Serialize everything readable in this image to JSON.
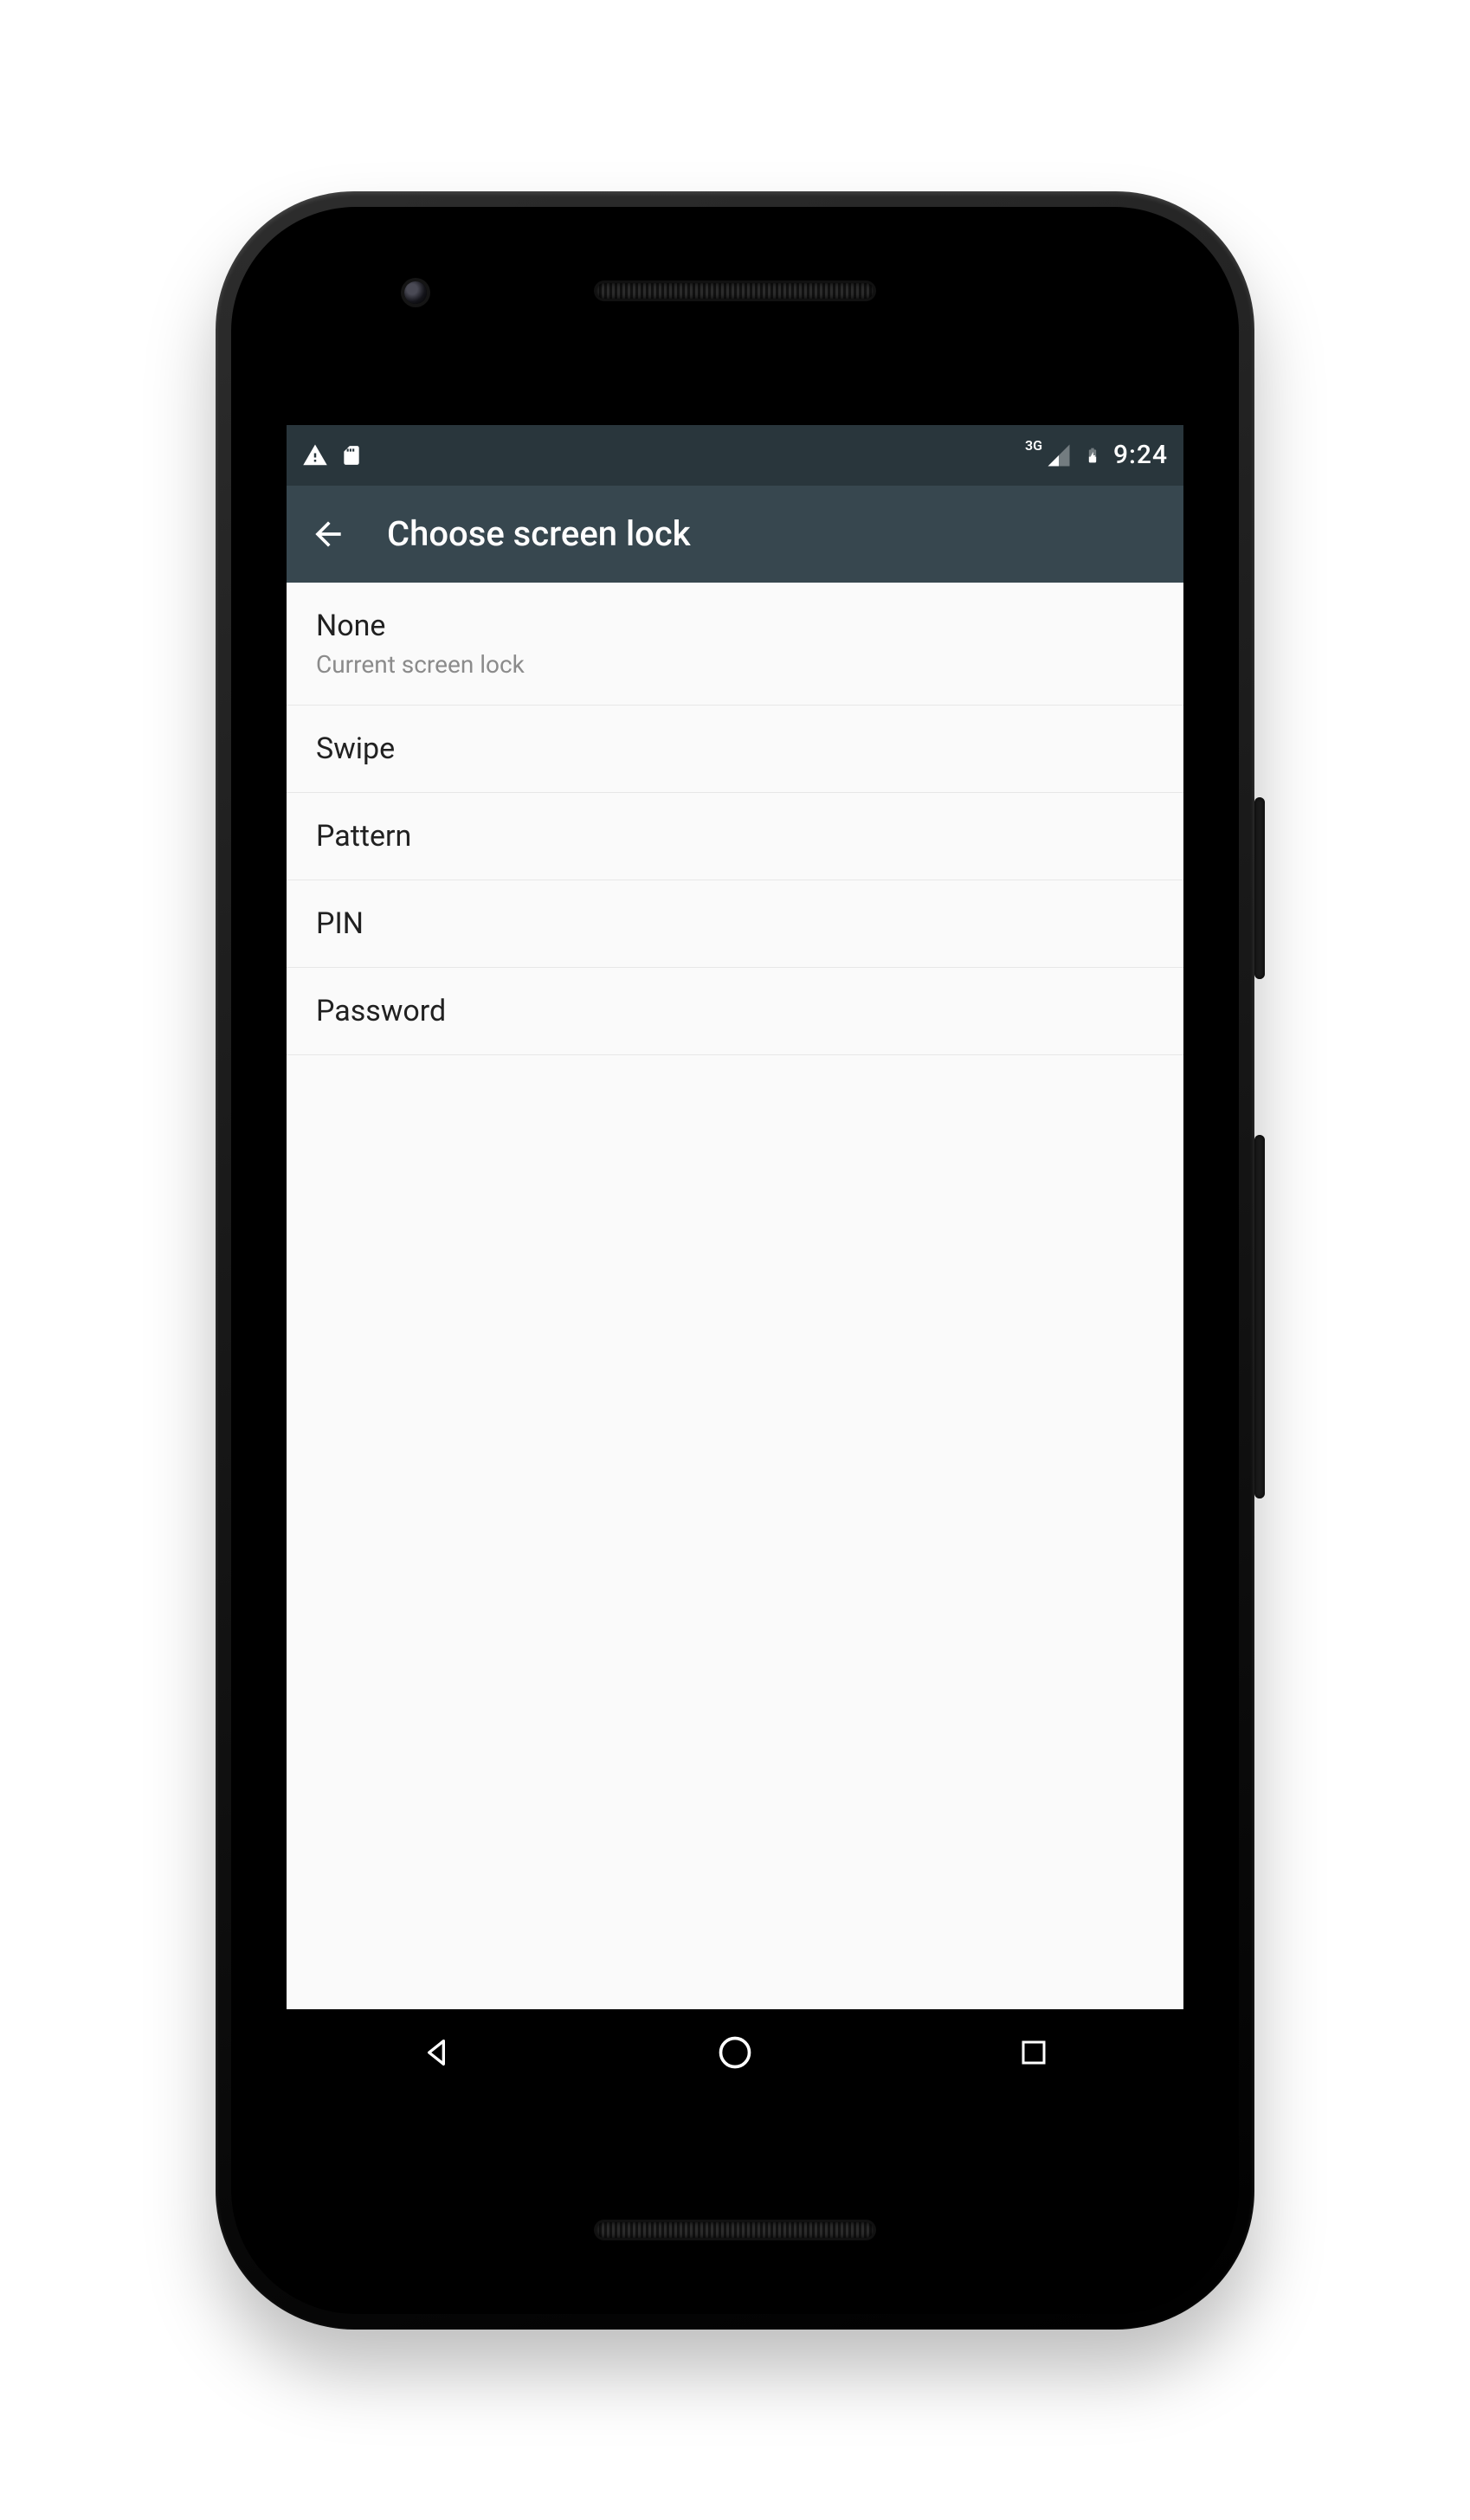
{
  "status": {
    "time": "9:24",
    "network_label": "3G",
    "icons": [
      "warning-icon",
      "sd-card-icon",
      "signal-icon",
      "battery-icon"
    ]
  },
  "appbar": {
    "title": "Choose screen lock"
  },
  "options": [
    {
      "label": "None",
      "sub": "Current screen lock"
    },
    {
      "label": "Swipe"
    },
    {
      "label": "Pattern"
    },
    {
      "label": "PIN"
    },
    {
      "label": "Password"
    }
  ]
}
